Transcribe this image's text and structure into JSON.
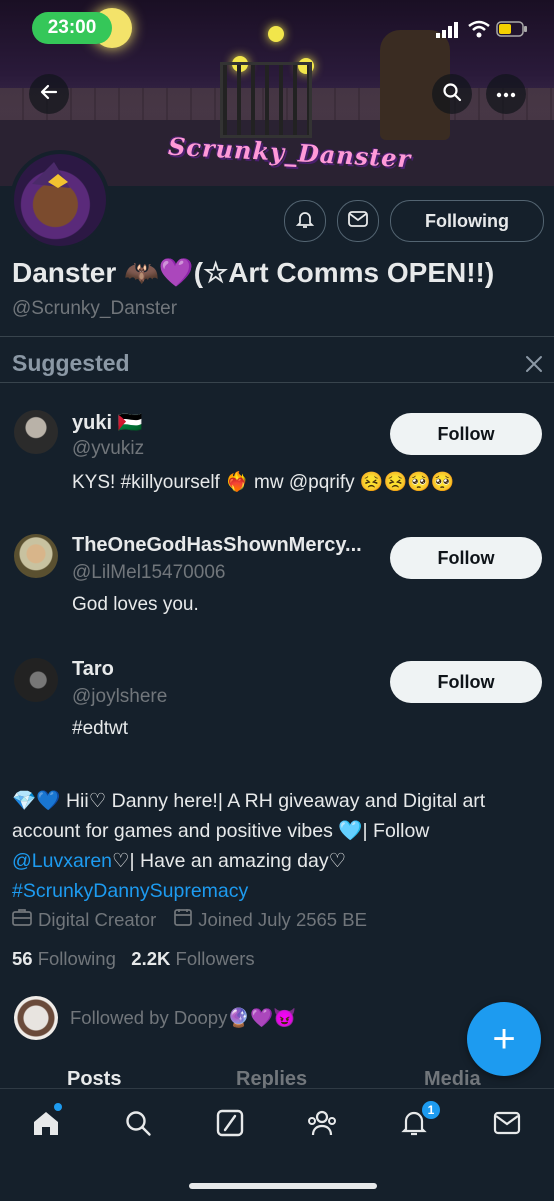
{
  "status_bar": {
    "time": "23:00"
  },
  "banner": {
    "title": "Scrunky_Danster"
  },
  "profile": {
    "display_name": "Danster 🦇💜(☆Art Comms OPEN!!)",
    "handle": "@Scrunky_Danster",
    "following_label": "Following"
  },
  "suggested": {
    "title": "Suggested",
    "items": [
      {
        "name": "yuki 🇵🇸",
        "handle": "@yvukiz",
        "bio": "KYS! #killyourself ❤️‍🔥 mw @pqrify 😣😣🥺🥺",
        "button": "Follow"
      },
      {
        "name": "TheOneGodHasShownMercy...",
        "handle": "@LilMel15470006",
        "bio": "God loves you.",
        "button": "Follow"
      },
      {
        "name": "Taro",
        "handle": "@joylshere",
        "bio": "#edtwt",
        "button": "Follow"
      }
    ]
  },
  "bio": {
    "line1": "💎💙 Hii♡ Danny here!| A RH giveaway and Digital art account for games and positive vibes 🩵| Follow",
    "mention": "@Luvxaren",
    "line2": "♡| Have an amazing day♡",
    "hashtag": "#ScrunkyDannySupremacy"
  },
  "meta": {
    "category": "Digital Creator",
    "joined": "Joined July 2565 BE"
  },
  "stats": {
    "following_count": "56",
    "following_label": "Following",
    "followers_count": "2.2K",
    "followers_label": "Followers"
  },
  "followed_by": "Followed by Doopy🔮💜😈",
  "tabs": [
    "Posts",
    "Replies",
    "Media"
  ],
  "fab_label": "+",
  "nav": {
    "notifications_badge": "1"
  },
  "colors": {
    "accent": "#1d9bf0",
    "background": "#15202b",
    "muted": "#71767b",
    "status_green": "#35c759"
  }
}
